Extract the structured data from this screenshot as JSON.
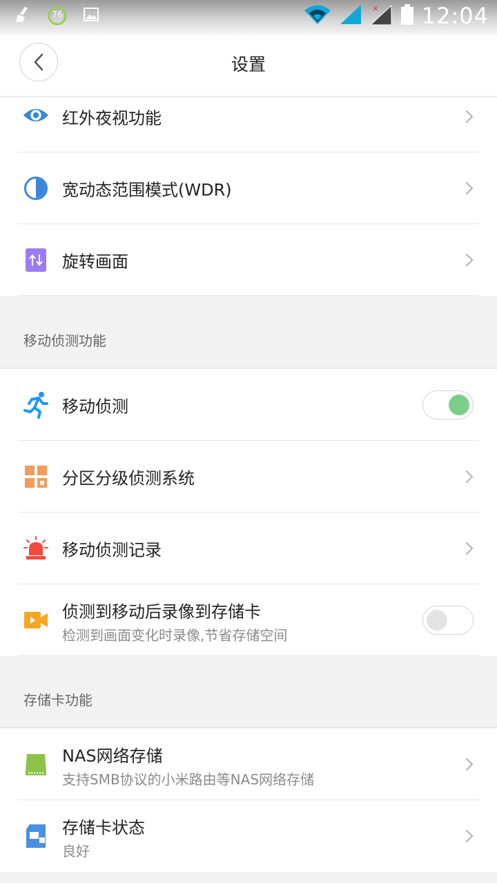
{
  "status_bar": {
    "time": "12:04",
    "notification_badge": "76"
  },
  "header": {
    "title": "设置"
  },
  "items_top": [
    {
      "label": "红外夜视功能",
      "icon": "eye-icon"
    },
    {
      "label": "宽动态范围模式(WDR)",
      "icon": "half-circle-icon"
    },
    {
      "label": "旋转画面",
      "icon": "rotate-icon"
    }
  ],
  "section_motion": {
    "title": "移动侦测功能",
    "items": [
      {
        "label": "移动侦测",
        "icon": "running-person-icon",
        "toggle": "on"
      },
      {
        "label": "分区分级侦测系统",
        "icon": "grid-icon"
      },
      {
        "label": "移动侦测记录",
        "icon": "alarm-light-icon"
      },
      {
        "label": "侦测到移动后录像到存储卡",
        "sub": "检测到画面变化时录像,节省存储空间",
        "icon": "video-camera-icon",
        "toggle": "off"
      }
    ]
  },
  "section_storage": {
    "title": "存储卡功能",
    "items": [
      {
        "label": "NAS网络存储",
        "sub": "支持SMB协议的小米路由等NAS网络存储",
        "icon": "hard-drive-icon"
      },
      {
        "label": "存储卡状态",
        "sub": "良好",
        "icon": "sd-card-icon"
      }
    ]
  },
  "colors": {
    "toggle_on": "#7bcf8a",
    "eye_icon": "#3b86d9",
    "alarm_icon": "#f04a3c",
    "grid_icon": "#f39b5b",
    "video_icon": "#f5a623",
    "drive_icon": "#8bc34a",
    "sd_icon": "#4a8fe0",
    "rotate_icon": "#9c7cf0"
  }
}
